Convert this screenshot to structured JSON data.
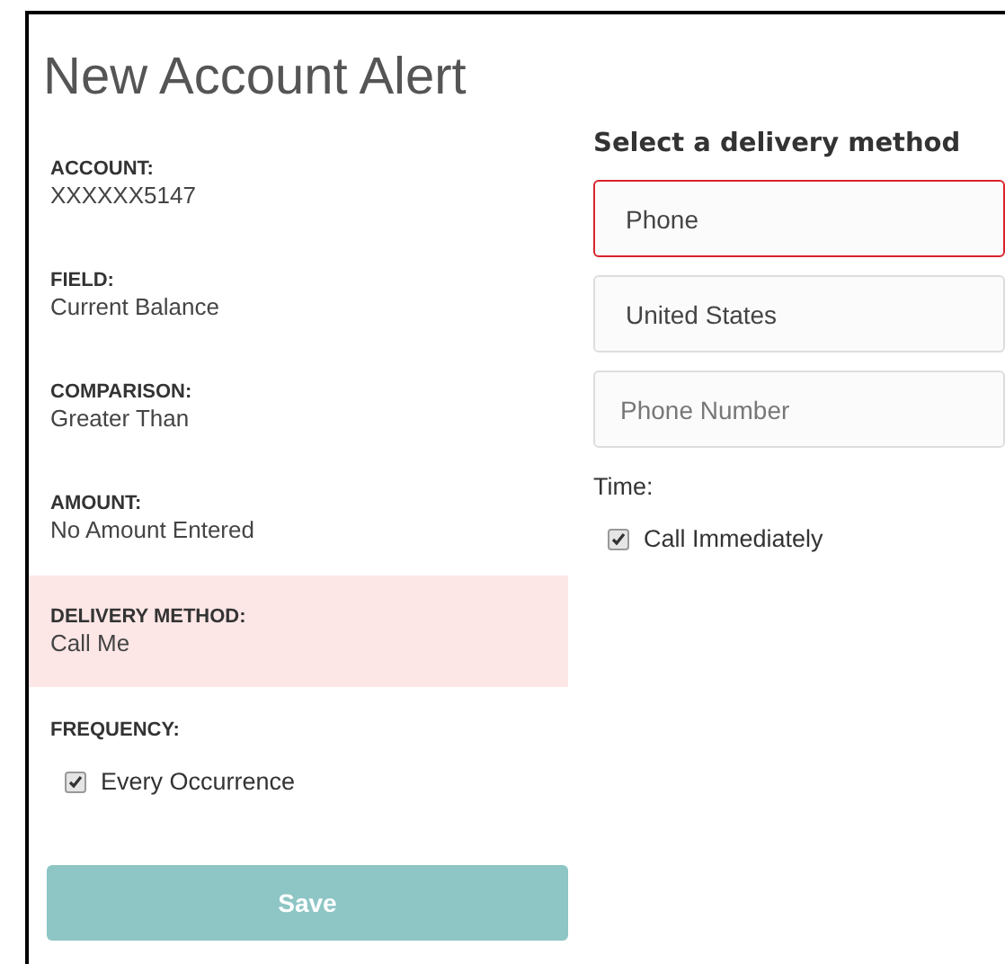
{
  "title": "New Account Alert",
  "summary": [
    {
      "label": "ACCOUNT:",
      "value": "XXXXXX5147",
      "highlighted": false
    },
    {
      "label": "FIELD:",
      "value": "Current Balance",
      "highlighted": false
    },
    {
      "label": "COMPARISON:",
      "value": "Greater Than",
      "highlighted": false
    },
    {
      "label": "AMOUNT:",
      "value": "No Amount Entered",
      "highlighted": false
    },
    {
      "label": "DELIVERY METHOD:",
      "value": "Call Me",
      "highlighted": true
    }
  ],
  "frequency": {
    "label": "FREQUENCY:",
    "option": {
      "label": "Every Occurrence",
      "checked": true
    }
  },
  "save_button": {
    "label": "Save",
    "disabled": true
  },
  "delivery": {
    "heading": "Select a delivery method",
    "fields": [
      {
        "kind": "select",
        "value": "Phone",
        "error": true
      },
      {
        "kind": "select",
        "value": "United States",
        "error": false
      },
      {
        "kind": "input",
        "placeholder": "Phone Number",
        "error": false
      }
    ],
    "time": {
      "label": "Time:",
      "option": {
        "label": "Call Immediately",
        "checked": true
      }
    }
  }
}
